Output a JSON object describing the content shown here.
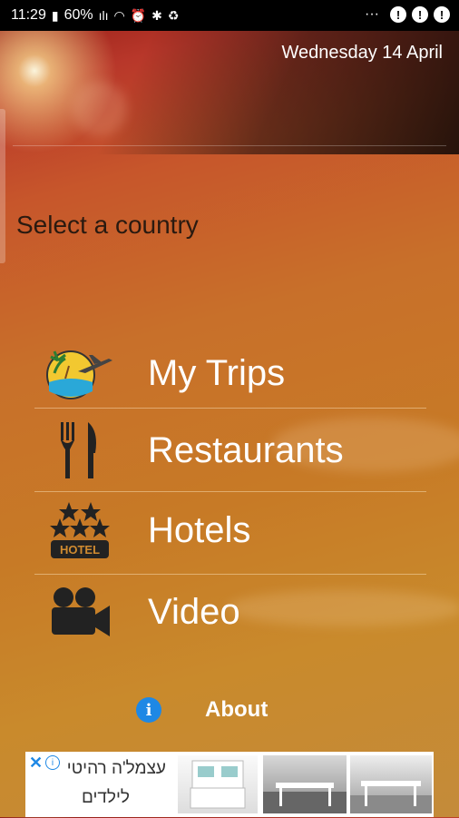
{
  "status_bar": {
    "time": "11:29",
    "battery": "60%",
    "icons_left": [
      "battery-icon",
      "signal-bars-icon",
      "wifi-icon",
      "alarm-icon",
      "bluetooth-icon",
      "recycle-icon"
    ],
    "more": "···",
    "alerts": [
      "!",
      "!",
      "!"
    ]
  },
  "header": {
    "date": "Wednesday 14 April"
  },
  "country_selector": {
    "label": "Select a country"
  },
  "menu": {
    "items": [
      {
        "label": "My Trips",
        "icon": "travel-plane-icon"
      },
      {
        "label": "Restaurants",
        "icon": "fork-knife-icon"
      },
      {
        "label": "Hotels",
        "icon": "hotel-stars-icon"
      },
      {
        "label": "Video",
        "icon": "video-camera-icon"
      }
    ]
  },
  "about": {
    "icon_text": "i",
    "label": "About"
  },
  "ad": {
    "line1": "עצמל'ה רהיטי",
    "line2": "לילדים",
    "close": "✕",
    "info": "i"
  },
  "colors": {
    "accent": "#1e88e5",
    "text_dark": "#2a1a10"
  }
}
